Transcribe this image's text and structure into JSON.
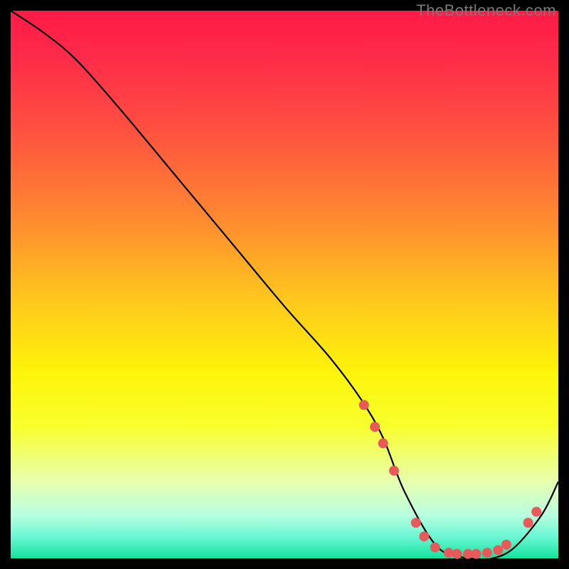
{
  "watermark": "TheBottleneck.com",
  "chart_data": {
    "type": "line",
    "title": "",
    "xlabel": "",
    "ylabel": "",
    "xlim": [
      0,
      100
    ],
    "ylim": [
      0,
      100
    ],
    "grid": false,
    "series": [
      {
        "name": "curve",
        "x": [
          0,
          6,
          12,
          20,
          30,
          40,
          50,
          58,
          64,
          68,
          72,
          78,
          84,
          88,
          92,
          97,
          100
        ],
        "y": [
          100,
          96,
          91,
          82,
          70,
          58,
          46,
          37,
          29,
          22,
          12,
          2,
          0,
          0,
          2,
          8,
          14
        ]
      }
    ],
    "markers": [
      {
        "x": 64.5,
        "y": 28.0
      },
      {
        "x": 66.5,
        "y": 24.0
      },
      {
        "x": 68.0,
        "y": 21.0
      },
      {
        "x": 70.0,
        "y": 16.0
      },
      {
        "x": 74.0,
        "y": 6.5
      },
      {
        "x": 75.5,
        "y": 4.0
      },
      {
        "x": 77.5,
        "y": 2.0
      },
      {
        "x": 80.0,
        "y": 1.0
      },
      {
        "x": 81.5,
        "y": 0.8
      },
      {
        "x": 83.5,
        "y": 0.8
      },
      {
        "x": 85.0,
        "y": 0.8
      },
      {
        "x": 87.0,
        "y": 1.0
      },
      {
        "x": 89.0,
        "y": 1.5
      },
      {
        "x": 90.5,
        "y": 2.5
      },
      {
        "x": 94.5,
        "y": 6.5
      },
      {
        "x": 96.0,
        "y": 8.5
      }
    ],
    "marker_style": {
      "color": "#e85a5a",
      "radius_px": 7
    }
  }
}
